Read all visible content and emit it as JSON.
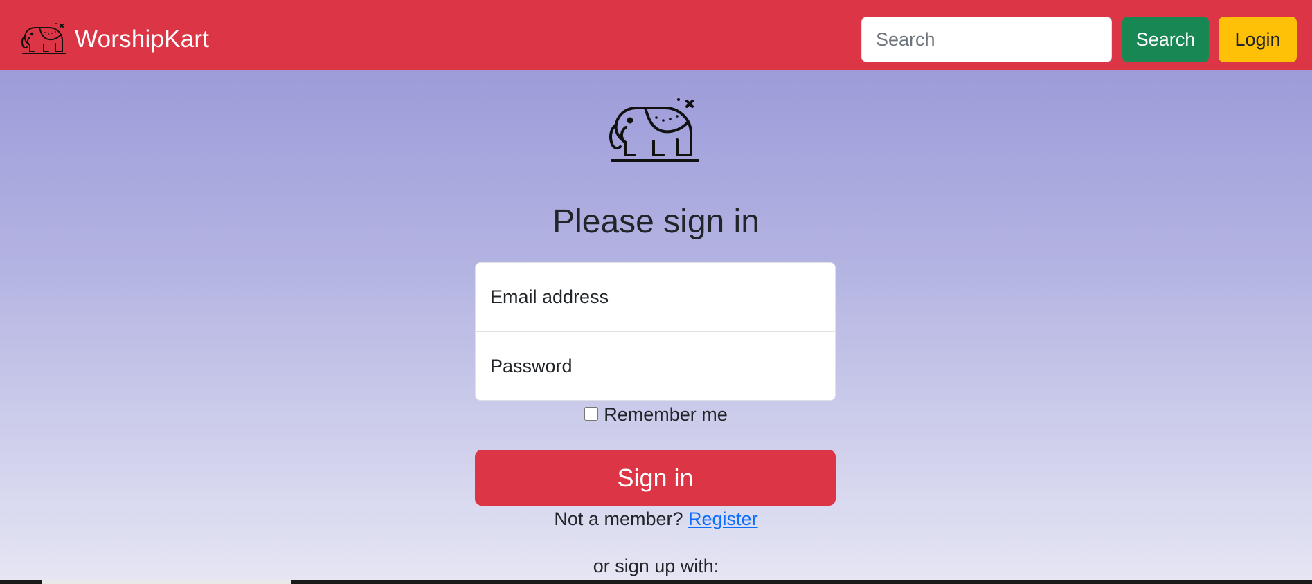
{
  "navbar": {
    "brand_name": "WorshipKart",
    "logo_icon": "elephant-icon",
    "search": {
      "placeholder": "Search",
      "value": ""
    },
    "search_button_label": "Search",
    "login_button_label": "Login",
    "background_color": "#dc3545"
  },
  "signin_form": {
    "logo_icon": "elephant-icon",
    "heading": "Please sign in",
    "email_placeholder": "Email address",
    "password_placeholder": "Password",
    "remember_me_label": "Remember me",
    "remember_me_checked": false,
    "signin_button_label": "Sign in",
    "not_member_text": "Not a member?",
    "register_link_label": "Register",
    "signup_with_text": "or sign up with:"
  },
  "colors": {
    "primary_red": "#dc3545",
    "success_green": "#198754",
    "warning_yellow": "#ffc107",
    "link_blue": "#0d6efd"
  }
}
